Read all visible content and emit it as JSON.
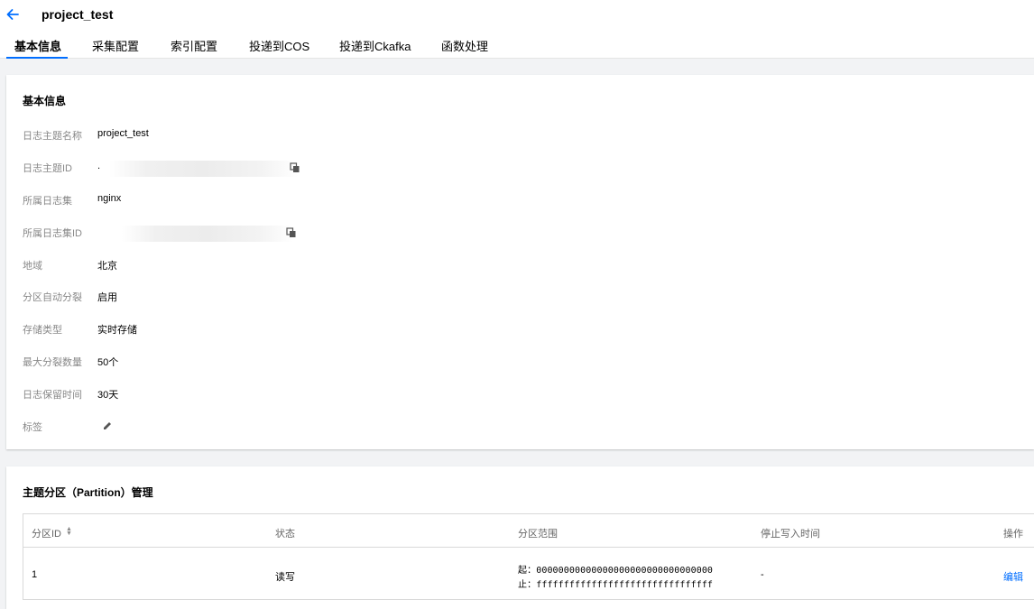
{
  "header": {
    "title": "project_test",
    "tabs": [
      {
        "label": "基本信息",
        "active": true
      },
      {
        "label": "采集配置",
        "active": false
      },
      {
        "label": "索引配置",
        "active": false
      },
      {
        "label": "投递到COS",
        "active": false
      },
      {
        "label": "投递到Ckafka",
        "active": false
      },
      {
        "label": "函数处理",
        "active": false
      }
    ]
  },
  "basic_info": {
    "title": "基本信息",
    "rows": [
      {
        "label": "日志主题名称",
        "value": "project_test"
      },
      {
        "label": "日志主题ID",
        "value": "."
      },
      {
        "label": "所属日志集",
        "value": "nginx"
      },
      {
        "label": "所属日志集ID",
        "value": ""
      },
      {
        "label": "地域",
        "value": "北京"
      },
      {
        "label": "分区自动分裂",
        "value": "启用"
      },
      {
        "label": "存储类型",
        "value": "实时存储"
      },
      {
        "label": "最大分裂数量",
        "value": "50个"
      },
      {
        "label": "日志保留时间",
        "value": "30天"
      },
      {
        "label": "标签",
        "value": ""
      }
    ]
  },
  "partition": {
    "title": "主题分区（Partition）管理",
    "columns": [
      "分区ID",
      "状态",
      "分区范围",
      "停止写入时间",
      "操作"
    ],
    "rows": [
      {
        "id": "1",
        "status": "读写",
        "range_start": "起：00000000000000000000000000000000",
        "range_end": "止：ffffffffffffffffffffffffffffffff",
        "stop_time": "-",
        "action": "编辑"
      }
    ]
  },
  "colors": {
    "accent": "#006eff",
    "label": "#888888",
    "background": "#f2f3f5"
  },
  "icons": [
    "arrow-left-icon",
    "copy-icon",
    "pencil-icon",
    "sort-icon"
  ]
}
